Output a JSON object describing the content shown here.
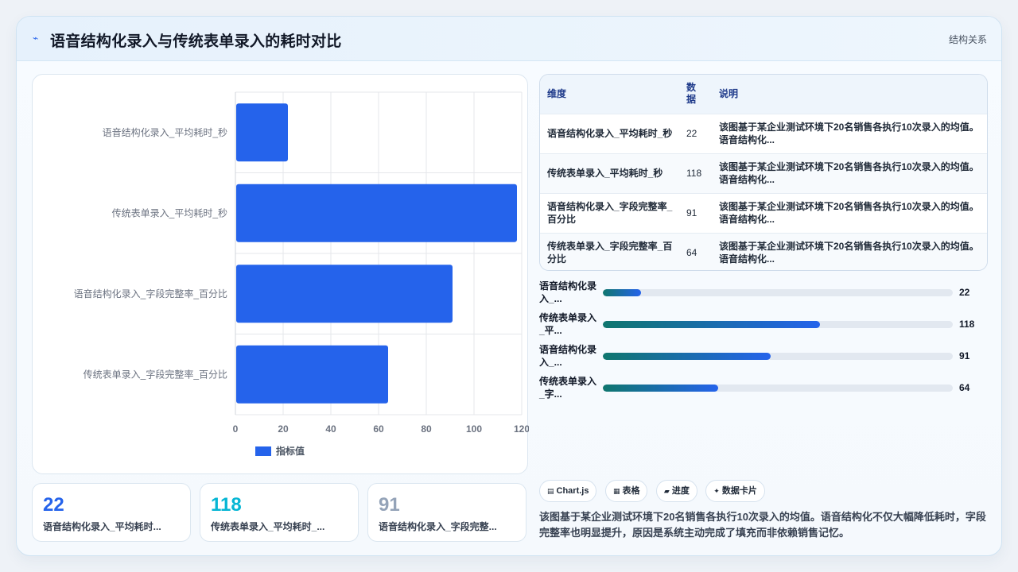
{
  "header": {
    "title": "语音结构化录入与传统表单录入的耗时对比",
    "tag": "结构关系",
    "logo_icon": "pulse-icon"
  },
  "chart_data": {
    "type": "bar",
    "orientation": "horizontal",
    "categories": [
      "语音结构化录入_平均耗时_秒",
      "传统表单录入_平均耗时_秒",
      "语音结构化录入_字段完整率_百分比",
      "传统表单录入_字段完整率_百分比"
    ],
    "series": [
      {
        "name": "指标值",
        "values": [
          22,
          118,
          91,
          64
        ]
      }
    ],
    "xlim": [
      0,
      120
    ],
    "xticks": [
      "0",
      "20",
      "40",
      "60",
      "80",
      "100",
      "120"
    ],
    "grid": true,
    "legend": "bottom",
    "bar_color": "#2563eb"
  },
  "stats": [
    {
      "value": "22",
      "label": "语音结构化录入_平均耗时...",
      "color": "#2563eb"
    },
    {
      "value": "118",
      "label": "传统表单录入_平均耗时_...",
      "color": "#06b6d4"
    },
    {
      "value": "91",
      "label": "语音结构化录入_字段完整...",
      "color": "#94a3b8"
    }
  ],
  "table": {
    "headers": [
      "维度",
      "数据",
      "说明"
    ],
    "rows": [
      {
        "dim": "语音结构化录入_平均耗时_秒",
        "val": "22",
        "desc": "该图基于某企业测试环境下20名销售各执行10次录入的均值。语音结构化..."
      },
      {
        "dim": "传统表单录入_平均耗时_秒",
        "val": "118",
        "desc": "该图基于某企业测试环境下20名销售各执行10次录入的均值。语音结构化..."
      },
      {
        "dim": "语音结构化录入_字段完整率_百分比",
        "val": "91",
        "desc": "该图基于某企业测试环境下20名销售各执行10次录入的均值。语音结构化..."
      },
      {
        "dim": "传统表单录入_字段完整率_百分比",
        "val": "64",
        "desc": "该图基于某企业测试环境下20名销售各执行10次录入的均值。语音结构化..."
      }
    ]
  },
  "progress": [
    {
      "label": "语音结构化录入_...",
      "value": "22",
      "fraction": 0.11
    },
    {
      "label": "传统表单录入_平...",
      "value": "118",
      "fraction": 0.62
    },
    {
      "label": "语音结构化录入_...",
      "value": "91",
      "fraction": 0.48
    },
    {
      "label": "传统表单录入_字...",
      "value": "64",
      "fraction": 0.33
    }
  ],
  "chips": [
    {
      "icon": "chart-icon",
      "glyph": "▤",
      "label": "Chart.js"
    },
    {
      "icon": "table-icon",
      "glyph": "▦",
      "label": "表格"
    },
    {
      "icon": "progress-icon",
      "glyph": "▰",
      "label": "进度"
    },
    {
      "icon": "card-icon",
      "glyph": "✦",
      "label": "数据卡片"
    }
  ],
  "summary": "该图基于某企业测试环境下20名销售各执行10次录入的均值。语音结构化不仅大幅降低耗时，字段完整率也明显提升，原因是系统主动完成了填充而非依赖销售记忆。"
}
